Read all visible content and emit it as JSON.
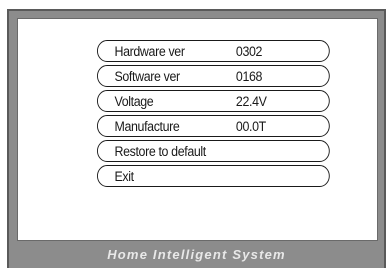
{
  "menu": {
    "items": [
      {
        "label": "Hardware ver",
        "value": "0302"
      },
      {
        "label": "Software ver",
        "value": "0168"
      },
      {
        "label": "Voltage",
        "value": "22.4V"
      },
      {
        "label": "Manufacture",
        "value": "00.0T"
      },
      {
        "label": "Restore to default",
        "value": ""
      },
      {
        "label": "Exit",
        "value": ""
      }
    ]
  },
  "footer": {
    "text": "Home Intelligent System"
  }
}
